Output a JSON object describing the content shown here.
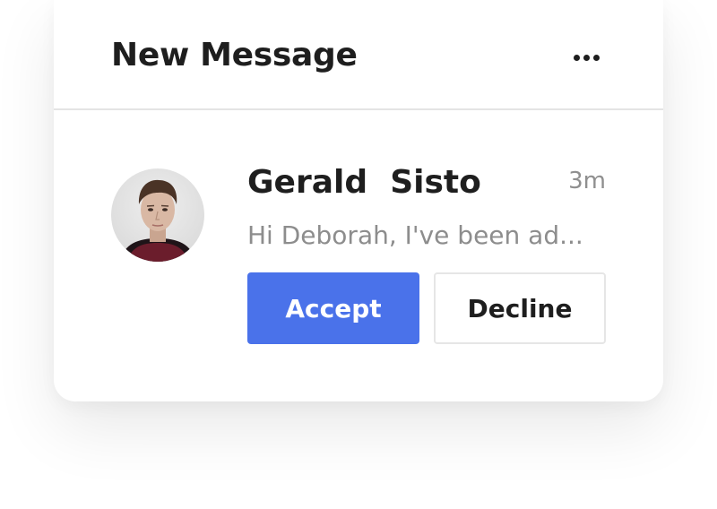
{
  "notification": {
    "title": "New Message",
    "menu_icon": "more-horizontal-icon",
    "message": {
      "sender": "Gerald  Sisto",
      "time": "3m",
      "preview": "Hi Deborah, I've been ad...",
      "avatar": "avatar-photo"
    },
    "actions": {
      "accept_label": "Accept",
      "decline_label": "Decline"
    }
  },
  "colors": {
    "accent": "#4a72ea",
    "title_text": "#1e1e1e",
    "secondary_text": "#8d8d8d",
    "divider": "#e4e4e4"
  }
}
